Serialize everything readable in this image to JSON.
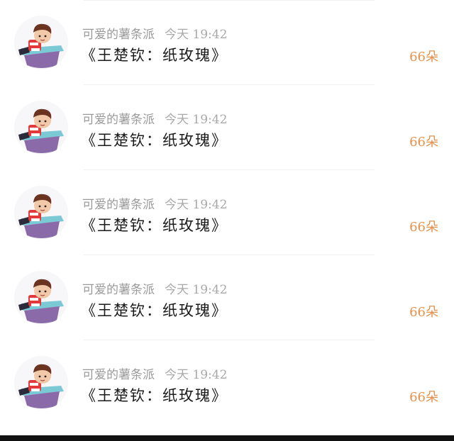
{
  "gifts": [
    {
      "sender": "可爱的薯条派",
      "time": "今天 19:42",
      "title": "《王楚钦：纸玫瑰》",
      "count": "66朵",
      "avatar_icon": "cartoon-boy-avatar"
    },
    {
      "sender": "可爱的薯条派",
      "time": "今天 19:42",
      "title": "《王楚钦：纸玫瑰》",
      "count": "66朵",
      "avatar_icon": "cartoon-boy-avatar"
    },
    {
      "sender": "可爱的薯条派",
      "time": "今天 19:42",
      "title": "《王楚钦：纸玫瑰》",
      "count": "66朵",
      "avatar_icon": "cartoon-boy-avatar"
    },
    {
      "sender": "可爱的薯条派",
      "time": "今天 19:42",
      "title": "《王楚钦：纸玫瑰》",
      "count": "66朵",
      "avatar_icon": "cartoon-boy-avatar"
    },
    {
      "sender": "可爱的薯条派",
      "time": "今天 19:42",
      "title": "《王楚钦：纸玫瑰》",
      "count": "66朵",
      "avatar_icon": "cartoon-boy-avatar"
    }
  ],
  "colors": {
    "count": "#e7904a",
    "meta": "#9a9a9a",
    "title": "#1a1a1a"
  }
}
